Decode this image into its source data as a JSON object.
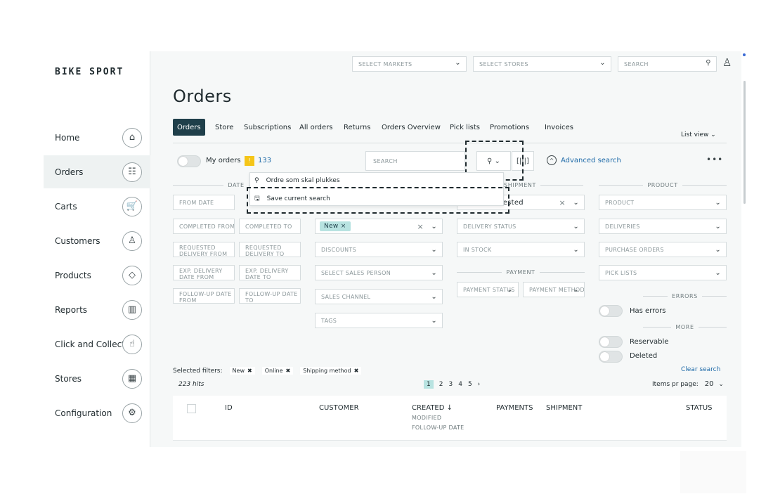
{
  "brand": "BIKE SPORT",
  "sidebar": {
    "items": [
      {
        "label": "Home",
        "icon": "⌂"
      },
      {
        "label": "Orders",
        "icon": "☷"
      },
      {
        "label": "Carts",
        "icon": "🛒"
      },
      {
        "label": "Customers",
        "icon": "♙"
      },
      {
        "label": "Products",
        "icon": "◇"
      },
      {
        "label": "Reports",
        "icon": "▥"
      },
      {
        "label": "Click and Collect",
        "icon": "☝"
      },
      {
        "label": "Stores",
        "icon": "▦"
      },
      {
        "label": "Configuration",
        "icon": "⚙"
      }
    ]
  },
  "topbar": {
    "markets": "SELECT MARKETS",
    "stores": "SELECT STORES",
    "search": "SEARCH"
  },
  "page_title": "Orders",
  "tabs": [
    "Orders",
    "Store",
    "Subscriptions",
    "All orders",
    "Returns",
    "Orders Overview",
    "Pick lists",
    "Promotions",
    "Invoices"
  ],
  "list_view": "List view ⌄",
  "my_orders": "My orders",
  "warn_icon": "!",
  "my_orders_count": "133",
  "order_search": "SEARCH",
  "advanced_search": "Advanced search",
  "more": "•••",
  "dropdown": {
    "saved": "Ordre som skal plukkes",
    "save": "Save current search"
  },
  "sections": {
    "date": "DATE",
    "shipment": "SHIPMENT",
    "product": "PRODUCT",
    "payment": "PAYMENT",
    "errors": "ERRORS",
    "more": "MORE"
  },
  "date_fields": {
    "from_date": "FROM DATE",
    "completed_from": "COMPLETED FROM",
    "completed_to": "COMPLETED TO",
    "req_from": "REQUESTED DELIVERY FROM",
    "req_to": "REQUESTED DELIVERY TO",
    "exp_from": "EXP. DELIVERY DATE FROM",
    "exp_to": "EXP. DELIVERY DATE TO",
    "fu_from": "FOLLOW-UP DATE FROM",
    "fu_to": "FOLLOW-UP DATE TO"
  },
  "status_chip": "New ×",
  "order_fields": {
    "discounts": "DISCOUNTS",
    "sales_person": "SELECT SALES PERSON",
    "sales_channel": "SALES CHANNEL",
    "tags": "TAGS"
  },
  "shipment_fields": {
    "method_value": "nested",
    "delivery_status": "DELIVERY STATUS",
    "in_stock": "IN STOCK",
    "payment_status": "PAYMENT STATUS",
    "payment_method": "PAYMENT METHOD"
  },
  "product_fields": {
    "product": "PRODUCT",
    "deliveries": "DELIVERIES",
    "purchase_orders": "PURCHASE ORDERS",
    "pick_lists": "PICK LISTS"
  },
  "toggles": {
    "has_errors": "Has errors",
    "reservable": "Reservable",
    "deleted": "Deleted"
  },
  "selected_filters": {
    "label": "Selected filters:",
    "items": [
      "New",
      "Online",
      "Shipping method"
    ]
  },
  "clear_search": "Clear search",
  "hits": "223 hits",
  "pages": [
    "1",
    "2",
    "3",
    "4",
    "5",
    "›"
  ],
  "items_per_page": "Items pr page:",
  "items_per_page_value": "20",
  "columns": {
    "id": "ID",
    "customer": "CUSTOMER",
    "created": "CREATED ↓",
    "modified": "MODIFIED",
    "followup": "FOLLOW-UP DATE",
    "payments": "PAYMENTS",
    "shipment": "SHIPMENT",
    "status": "STATUS"
  }
}
